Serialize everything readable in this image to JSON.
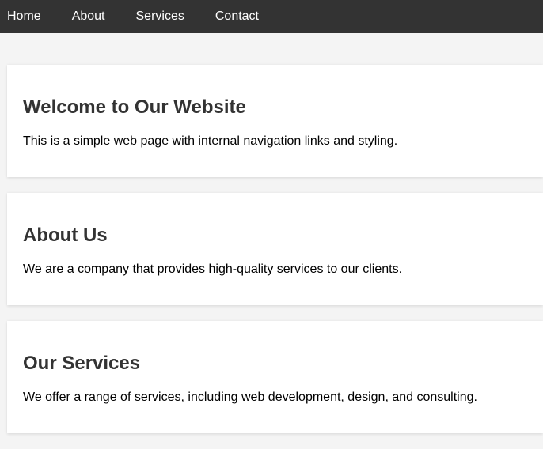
{
  "nav": {
    "items": [
      {
        "label": "Home"
      },
      {
        "label": "About"
      },
      {
        "label": "Services"
      },
      {
        "label": "Contact"
      }
    ]
  },
  "sections": [
    {
      "title": "Welcome to Our Website",
      "text": "This is a simple web page with internal navigation links and styling."
    },
    {
      "title": "About Us",
      "text": "We are a company that provides high-quality services to our clients."
    },
    {
      "title": "Our Services",
      "text": "We offer a range of services, including web development, design, and consulting."
    }
  ],
  "colors": {
    "nav_bg": "#333333",
    "page_bg": "#f4f4f4",
    "heading": "#333333"
  }
}
